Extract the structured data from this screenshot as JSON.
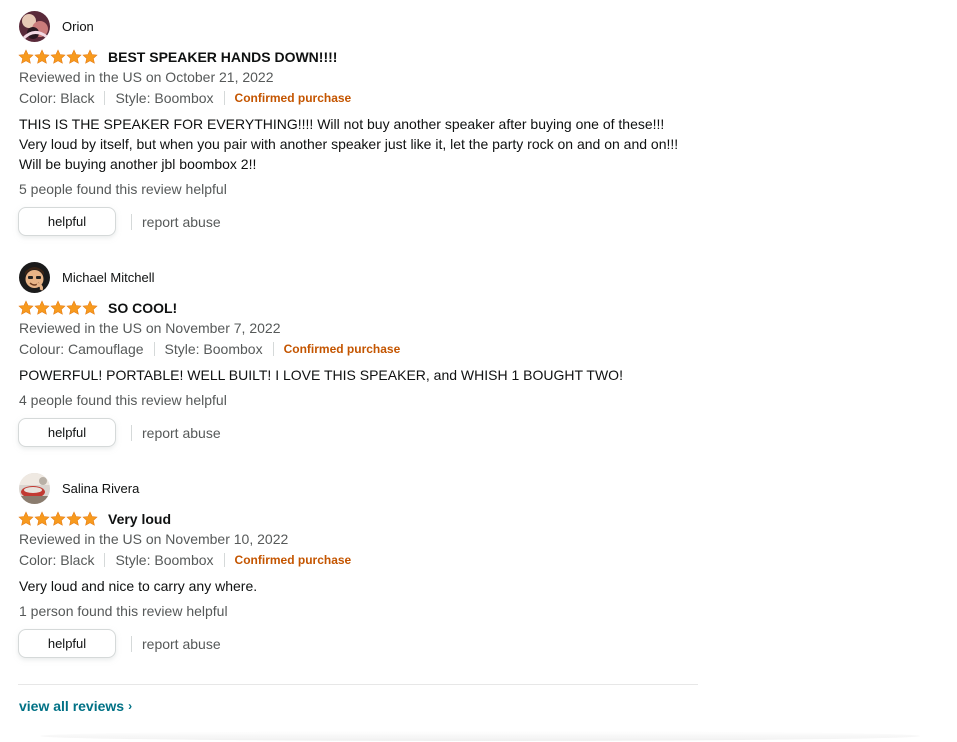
{
  "reviews": [
    {
      "name": "Orion",
      "rating": 5,
      "title": "BEST SPEAKER HANDS DOWN!!!!",
      "date": "Reviewed in the US on October 21, 2022",
      "variant1": "Color: Black",
      "variant2": "Style: Boombox",
      "badge": "Confirmed purchase",
      "body": "THIS IS THE SPEAKER FOR EVERYTHING!!!! Will not buy another speaker after buying one of these!!! Very loud by itself, but when you pair with another speaker just like it, let the party rock on and on and on!!! Will be buying another jbl boombox 2!!",
      "helpful_count": "5 people found this review helpful",
      "helpful_label": "helpful",
      "report_label": "report abuse"
    },
    {
      "name": "Michael Mitchell",
      "rating": 5,
      "title": "SO COOL!",
      "date": "Reviewed in the US on November 7, 2022",
      "variant1": "Colour: Camouflage",
      "variant2": "Style: Boombox",
      "badge": "Confirmed purchase",
      "body": "POWERFUL! PORTABLE! WELL BUILT! I LOVE THIS SPEAKER, and WHISH 1 BOUGHT TWO!",
      "helpful_count": "4 people found this review helpful",
      "helpful_label": "helpful",
      "report_label": "report abuse"
    },
    {
      "name": "Salina Rivera",
      "rating": 5,
      "title": "Very loud",
      "date": "Reviewed in the US on November 10, 2022",
      "variant1": "Color: Black",
      "variant2": "Style: Boombox",
      "badge": "Confirmed purchase",
      "body": "Very loud and nice to carry any where.",
      "helpful_count": "1 person found this review helpful",
      "helpful_label": "helpful",
      "report_label": "report abuse"
    }
  ],
  "view_all": {
    "label": "view all reviews",
    "icon": "chevron-right-icon",
    "glyph": "›"
  },
  "colors": {
    "star": "#f79a1e",
    "link": "#007185",
    "badge": "#c45500",
    "secondary_text": "#565959"
  }
}
